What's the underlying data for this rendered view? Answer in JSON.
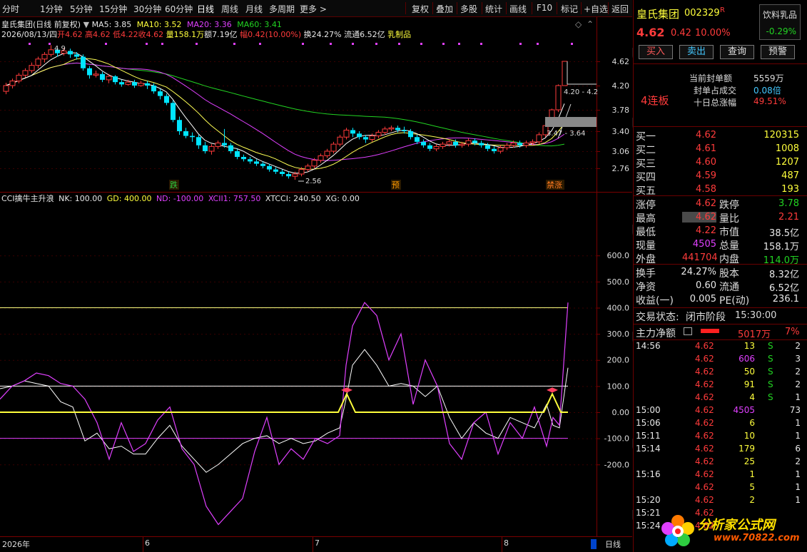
{
  "toolbar": {
    "left_items": [
      "分时",
      "1分钟",
      "5分钟",
      "15分钟",
      "30分钟",
      "60分钟",
      "日线",
      "周线",
      "月线",
      "多周期",
      "更多 >"
    ],
    "right_items": [
      "复权",
      "叠加",
      "多股",
      "统计",
      "画线",
      "F10",
      "标记",
      "+自选",
      "返回"
    ]
  },
  "chart_header": {
    "title": "皇氏集团(日线 前复权)",
    "ma5": "MA5: 3.85",
    "ma10": "MA10: 3.52",
    "ma20": "MA20: 3.36",
    "ma60": "MA60: 3.41",
    "info_date": "2026/08/13/四",
    "info_open": "开4.62",
    "info_high": "高4.62",
    "info_low": "低4.22",
    "info_close": "收4.62",
    "info_vol": "量158.1万",
    "info_amt": "额7.19亿",
    "info_chg": "幅0.42(10.00%)",
    "info_turn": "换24.27%",
    "info_float": "流通6.52亿",
    "info_sector": "乳制品"
  },
  "main_chart": {
    "y_ticks": [
      "4.62",
      "4.20",
      "3.78",
      "3.40",
      "3.06",
      "2.76"
    ],
    "high_label": "4.9",
    "low_label": "2.56",
    "annot_1": "4.20 - 4.2",
    "annot_2": "3.47 - 3.64",
    "markers": [
      "跌",
      "预",
      "禁涨"
    ],
    "colors": {
      "up": "#ff3b3b",
      "down": "#00e5ff",
      "ma5": "#ffffff",
      "ma10": "#ffff55",
      "ma20": "#e040ff",
      "ma60": "#22d422"
    }
  },
  "cci_header": {
    "title": "CCI擒牛主升浪",
    "nk": "NK: 100.00",
    "gd": "GD: 400.00",
    "nd": "ND: -100.00",
    "xcii": "XCII1: 757.50",
    "xtcci": "XTCCI: 240.50",
    "xg": "XG: 0.00"
  },
  "cci_chart": {
    "y_ticks": [
      "600.0",
      "500.0",
      "400.0",
      "300.0",
      "200.0",
      "100.0",
      "0.00",
      "-100.0",
      "-200.0"
    ]
  },
  "x_axis": {
    "labels": [
      "2026年",
      "6",
      "7",
      "8"
    ],
    "period": "日线"
  },
  "stock": {
    "name": "皇氏集团",
    "code": "002329",
    "flag": "R",
    "sector": "饮料乳品",
    "sector_chg": "-0.29%",
    "price": "4.62",
    "change": "0.42",
    "change_pct": "10.00%"
  },
  "actions": {
    "buy": "买入",
    "sell": "卖出",
    "query": "查询",
    "alert": "预警"
  },
  "limit_info": {
    "tag": "4连板",
    "seal_amount_label": "当前封单额",
    "seal_amount": "5559万",
    "seal_ratio_label": "封单占成交",
    "seal_ratio": "0.08倍",
    "ten_day_label": "十日总涨幅",
    "ten_day": "49.51%"
  },
  "order_book": [
    {
      "label": "买一",
      "price": "4.62",
      "vol": "120315"
    },
    {
      "label": "买二",
      "price": "4.61",
      "vol": "1008"
    },
    {
      "label": "买三",
      "price": "4.60",
      "vol": "1207"
    },
    {
      "label": "买四",
      "price": "4.59",
      "vol": "487"
    },
    {
      "label": "买五",
      "price": "4.58",
      "vol": "193"
    }
  ],
  "stats_1": [
    {
      "l1": "涨停",
      "v1": "4.62",
      "c1": "red",
      "l2": "跌停",
      "v2": "3.78",
      "c2": "grn"
    },
    {
      "l1": "最高",
      "v1": "4.62",
      "c1": "red",
      "l2": "量比",
      "v2": "2.21",
      "c2": "red"
    },
    {
      "l1": "最低",
      "v1": "4.22",
      "c1": "red",
      "l2": "市值",
      "v2": "38.5亿",
      "c2": "wht"
    },
    {
      "l1": "现量",
      "v1": "4505",
      "c1": "mag",
      "l2": "总量",
      "v2": "158.1万",
      "c2": "wht"
    },
    {
      "l1": "外盘",
      "v1": "441704",
      "c1": "red",
      "l2": "内盘",
      "v2": "114.0万",
      "c2": "grn"
    }
  ],
  "stats_2": [
    {
      "l1": "换手",
      "v1": "24.27%",
      "l2": "股本",
      "v2": "8.32亿"
    },
    {
      "l1": "净资",
      "v1": "0.60",
      "l2": "流通",
      "v2": "6.52亿"
    },
    {
      "l1": "收益(一)",
      "v1": "0.005",
      "l2": "PE(动)",
      "v2": "236.1"
    }
  ],
  "trade_status": {
    "label": "交易状态:",
    "value": "闭市阶段",
    "time": "15:30:00"
  },
  "main_flow": {
    "label": "主力净额",
    "value": "5017万",
    "pct": "7%"
  },
  "ticks": [
    {
      "time": "14:56",
      "price": "4.62",
      "vol": "13",
      "side": "S",
      "n": "2",
      "vc": "yel"
    },
    {
      "time": "",
      "price": "4.62",
      "vol": "606",
      "side": "S",
      "n": "3",
      "vc": "mag"
    },
    {
      "time": "",
      "price": "4.62",
      "vol": "50",
      "side": "S",
      "n": "2",
      "vc": "yel"
    },
    {
      "time": "",
      "price": "4.62",
      "vol": "91",
      "side": "S",
      "n": "2",
      "vc": "yel"
    },
    {
      "time": "",
      "price": "4.62",
      "vol": "4",
      "side": "S",
      "n": "1",
      "vc": "yel"
    },
    {
      "time": "15:00",
      "price": "4.62",
      "vol": "4505",
      "side": "",
      "n": "73",
      "vc": "mag"
    },
    {
      "time": "15:06",
      "price": "4.62",
      "vol": "6",
      "side": "",
      "n": "1",
      "vc": "yel"
    },
    {
      "time": "15:11",
      "price": "4.62",
      "vol": "10",
      "side": "",
      "n": "1",
      "vc": "yel"
    },
    {
      "time": "15:14",
      "price": "4.62",
      "vol": "179",
      "side": "",
      "n": "6",
      "vc": "yel"
    },
    {
      "time": "",
      "price": "4.62",
      "vol": "25",
      "side": "",
      "n": "2",
      "vc": "yel"
    },
    {
      "time": "15:16",
      "price": "4.62",
      "vol": "1",
      "side": "",
      "n": "1",
      "vc": "yel"
    },
    {
      "time": "",
      "price": "4.62",
      "vol": "5",
      "side": "",
      "n": "1",
      "vc": "yel"
    },
    {
      "time": "15:20",
      "price": "4.62",
      "vol": "2",
      "side": "",
      "n": "1",
      "vc": "yel"
    },
    {
      "time": "15:21",
      "price": "4.62",
      "vol": "",
      "side": "",
      "n": "",
      "vc": "yel"
    },
    {
      "time": "15:24",
      "price": "4.62",
      "vol": "",
      "side": "",
      "n": "",
      "vc": "yel"
    }
  ],
  "watermark": {
    "text": "分析家公式网www.70822.com",
    "logo_cn": "分析家公式网",
    "logo_url": "www.70822.com"
  }
}
